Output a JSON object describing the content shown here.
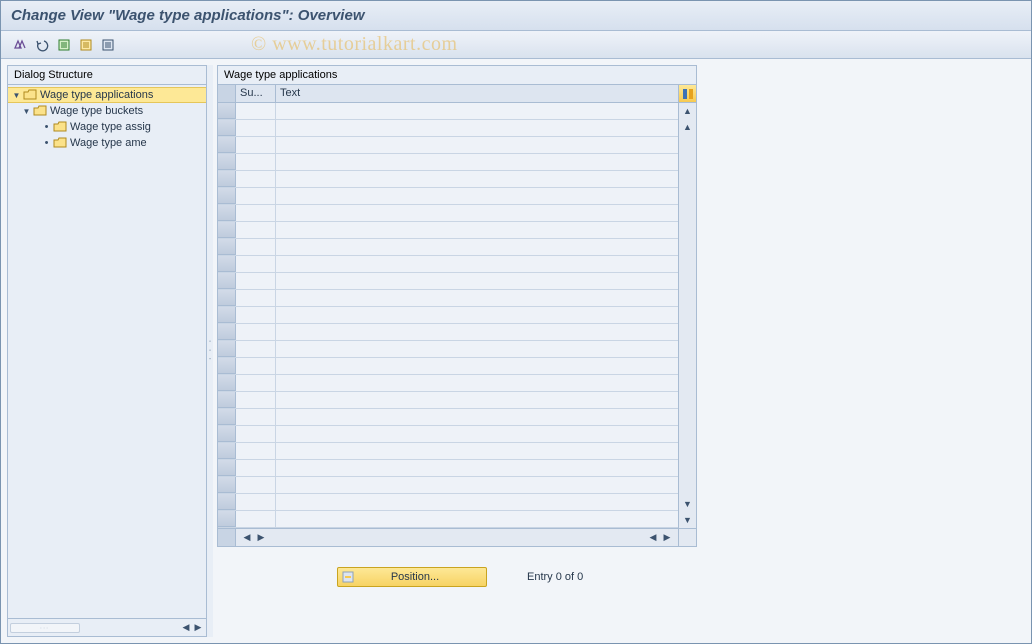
{
  "title": "Change View \"Wage type applications\": Overview",
  "watermark": "© www.tutorialkart.com",
  "toolbar_icons": [
    "edit-icon",
    "undo-icon",
    "new-entries-icon",
    "copy-icon",
    "delete-icon"
  ],
  "sidebar": {
    "title": "Dialog Structure",
    "nodes": [
      {
        "label": "Wage type applications",
        "selected": true,
        "open": true
      },
      {
        "label": "Wage type buckets",
        "open": true
      },
      {
        "label": "Wage type assig"
      },
      {
        "label": "Wage type ame"
      }
    ]
  },
  "grid": {
    "title": "Wage type applications",
    "columns": [
      {
        "label": "Su..."
      },
      {
        "label": "Text"
      }
    ],
    "row_count": 25
  },
  "footer": {
    "position_label": "Position...",
    "entry_text": "Entry 0 of 0"
  }
}
